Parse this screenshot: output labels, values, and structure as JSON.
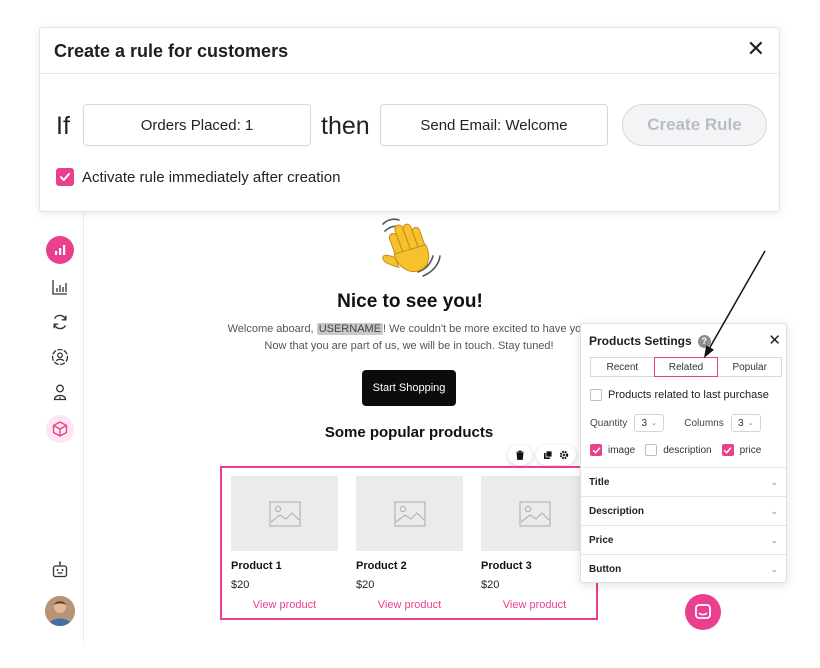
{
  "dialog": {
    "title": "Create a rule for customers",
    "close_glyph": "✕",
    "if_word": "If",
    "condition_value": "Orders Placed: 1",
    "then_word": "then",
    "action_value": "Send Email: Welcome",
    "create_button": "Create Rule",
    "activate_label": "Activate rule immediately after creation",
    "activate_checked": true
  },
  "sidebar": {
    "icons": [
      "analytics-icon",
      "bar-chart-icon",
      "refresh-icon",
      "user-circle-icon",
      "user-pin-icon",
      "box-icon",
      "bot-icon"
    ]
  },
  "email": {
    "headline": "Nice to see you!",
    "welcome_before": "Welcome aboard,",
    "username_tag": "USERNAME",
    "welcome_after": "! We couldn't be more excited to have you. Now that you are part of us, we will be in touch. Stay tuned!",
    "cta": "Start Shopping",
    "popular_title": "Some popular products",
    "products": [
      {
        "name": "Product 1",
        "price": "$20",
        "link": "View product"
      },
      {
        "name": "Product 2",
        "price": "$20",
        "link": "View product"
      },
      {
        "name": "Product 3",
        "price": "$20",
        "link": "View product"
      }
    ]
  },
  "panel": {
    "title": "Products Settings",
    "help_glyph": "?",
    "close_glyph": "✕",
    "tabs": [
      "Recent",
      "Related",
      "Popular"
    ],
    "active_tab": "Related",
    "related_label": "Products related to last purchase",
    "quantity_label": "Quantity",
    "quantity_value": "3",
    "columns_label": "Columns",
    "columns_value": "3",
    "options": [
      {
        "label": "image",
        "checked": true
      },
      {
        "label": "description",
        "checked": false
      },
      {
        "label": "price",
        "checked": true
      }
    ],
    "sections": [
      "Title",
      "Description",
      "Price",
      "Button"
    ]
  },
  "colors": {
    "accent": "#ea3f8c",
    "button_dark": "#0c0c0c",
    "disabled_text": "#b9bcc4"
  }
}
